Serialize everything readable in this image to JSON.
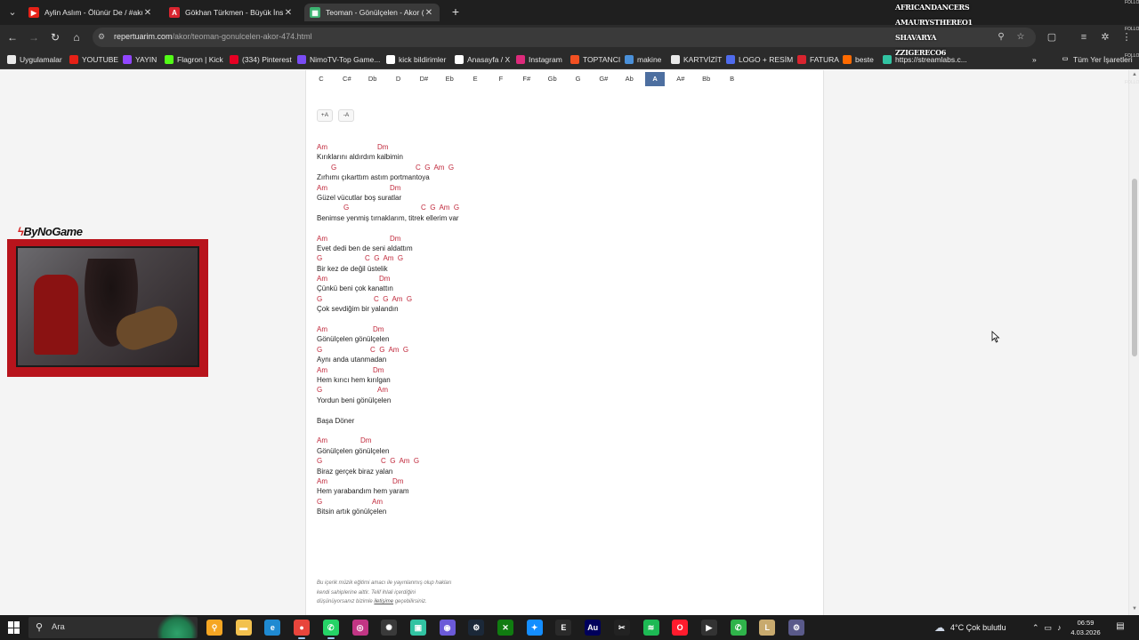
{
  "browser": {
    "tabs": [
      {
        "label": "Aylin Aslım - Ölünür De / #akus",
        "favicon": "youtube-icon",
        "color": "#e62117",
        "active": false
      },
      {
        "label": "Gökhan Türkmen - Büyük İnsan",
        "favicon": "A",
        "color": "#d9242f",
        "active": false
      },
      {
        "label": "Teoman - Gönülçelen - Akor (K",
        "favicon": "tabs-icon",
        "color": "#3cb371",
        "active": true
      }
    ],
    "url_host": "repertuarim.com",
    "url_path": "/akor/teoman-gonulcelen-akor-474.html",
    "overlay_names": [
      "AFRICANDANCERS",
      "AMAURYSTHEREO1",
      "SHAVARYA",
      "ZZIGERECO6"
    ],
    "side_tags": [
      "FOLLOW",
      "FOLLOW",
      "FOLLOW",
      "FOLLOW"
    ],
    "bookmarks": [
      {
        "label": "Uygulamalar",
        "icon": "apps-grid-icon",
        "color": "#e9e9e9"
      },
      {
        "label": "YOUTUBE",
        "icon": "youtube-icon",
        "color": "#e62117"
      },
      {
        "label": "YAYIN",
        "icon": "twitch-icon",
        "color": "#9146ff"
      },
      {
        "label": "Flagron | Kick",
        "icon": "kick-icon",
        "color": "#53fc18"
      },
      {
        "label": "(334) Pinterest",
        "icon": "pinterest-icon",
        "color": "#e60023"
      },
      {
        "label": "NimoTV-Top Game...",
        "icon": "nimo-icon",
        "color": "#7a4cf5"
      },
      {
        "label": "kick bildirimler",
        "icon": "kick-diamond-icon",
        "color": "#ffffff"
      },
      {
        "label": "Anasayfa / X",
        "icon": "x-icon",
        "color": "#ffffff"
      },
      {
        "label": "Instagram",
        "icon": "instagram-icon",
        "color": "#dd2a7b"
      },
      {
        "label": "TOPTANCI",
        "icon": "shop-icon",
        "color": "#f25022"
      },
      {
        "label": "makine",
        "icon": "doc-icon",
        "color": "#4a90d9"
      },
      {
        "label": "KARTVİZİT",
        "icon": "folder-icon",
        "color": "#e9e9e9"
      },
      {
        "label": "LOGO + RESİM",
        "icon": "logo-icon",
        "color": "#4f6bed"
      },
      {
        "label": "FATURA",
        "icon": "fatura-icon",
        "color": "#d9242f"
      },
      {
        "label": "beste",
        "icon": "beste-icon",
        "color": "#ff6a00"
      },
      {
        "label": "https://streamlabs.c...",
        "icon": "streamlabs-icon",
        "color": "#31c3a2"
      }
    ],
    "more_bookmarks": "»",
    "all_bookmarks": "Tüm Yer İşaretleri"
  },
  "page": {
    "keys": [
      "C",
      "C#",
      "Db",
      "D",
      "D#",
      "Eb",
      "E",
      "F",
      "F#",
      "Gb",
      "G",
      "G#",
      "Ab",
      "A",
      "A#",
      "Bb",
      "B"
    ],
    "selected_key": "A",
    "size_up": "+A",
    "size_down": "-A",
    "lyrics": [
      {
        "type": "chord",
        "chords": [
          {
            "c": "Am",
            "at": 0
          },
          {
            "c": "Dm",
            "at": 68
          }
        ]
      },
      {
        "type": "text",
        "t": "Kırıklarını aldırdım kalbimin"
      },
      {
        "type": "chord",
        "chords": [
          {
            "c": "G",
            "at": 16
          },
          {
            "c": "C  G  Am  G",
            "at": 111
          }
        ]
      },
      {
        "type": "text",
        "t": "Zırhımı çıkarttım astım portmantoya"
      },
      {
        "type": "chord",
        "chords": [
          {
            "c": "Am",
            "at": 0
          },
          {
            "c": "Dm",
            "at": 82
          }
        ]
      },
      {
        "type": "text",
        "t": "Güzel vücutlar boş suratlar"
      },
      {
        "type": "chord",
        "chords": [
          {
            "c": "G",
            "at": 30
          },
          {
            "c": "C  G  Am  G",
            "at": 117
          }
        ]
      },
      {
        "type": "text",
        "t": "Benimse yenmiş tırnaklarım, titrek ellerim var"
      },
      {
        "type": "blank"
      },
      {
        "type": "chord",
        "chords": [
          {
            "c": "Am",
            "at": 0
          },
          {
            "c": "Dm",
            "at": 82
          }
        ]
      },
      {
        "type": "text",
        "t": "Evet dedi ben de seni aldattım"
      },
      {
        "type": "chord",
        "chords": [
          {
            "c": "G",
            "at": 0
          },
          {
            "c": "C  G  Am  G",
            "at": 54
          }
        ]
      },
      {
        "type": "text",
        "t": "Bir kez de değil üstelik"
      },
      {
        "type": "chord",
        "chords": [
          {
            "c": "Am",
            "at": 0
          },
          {
            "c": "Dm",
            "at": 70
          }
        ]
      },
      {
        "type": "text",
        "t": "Çünkü beni çok kanattın"
      },
      {
        "type": "chord",
        "chords": [
          {
            "c": "G",
            "at": 0
          },
          {
            "c": "C  G  Am  G",
            "at": 64
          }
        ]
      },
      {
        "type": "text",
        "t": "Çok sevdiğim bir yalandın"
      },
      {
        "type": "blank"
      },
      {
        "type": "chord",
        "chords": [
          {
            "c": "Am",
            "at": 0
          },
          {
            "c": "Dm",
            "at": 63
          }
        ]
      },
      {
        "type": "text",
        "t": "Gönülçelen gönülçelen"
      },
      {
        "type": "chord",
        "chords": [
          {
            "c": "G",
            "at": 0
          },
          {
            "c": "C  G  Am  G",
            "at": 60
          }
        ]
      },
      {
        "type": "text",
        "t": "Aynı anda utanmadan"
      },
      {
        "type": "chord",
        "chords": [
          {
            "c": "Am",
            "at": 0
          },
          {
            "c": "Dm",
            "at": 63
          }
        ]
      },
      {
        "type": "text",
        "t": "Hem kırıcı hem kırılgan"
      },
      {
        "type": "chord",
        "chords": [
          {
            "c": "G",
            "at": 0
          },
          {
            "c": "Am",
            "at": 68
          }
        ]
      },
      {
        "type": "text",
        "t": "Yordun beni gönülçelen"
      },
      {
        "type": "blank"
      },
      {
        "type": "text",
        "t": "Başa Döner"
      },
      {
        "type": "blank"
      },
      {
        "type": "chord",
        "chords": [
          {
            "c": "Am",
            "at": 0
          },
          {
            "c": "Dm",
            "at": 49
          }
        ]
      },
      {
        "type": "text",
        "t": "Gönülçelen gönülçelen"
      },
      {
        "type": "chord",
        "chords": [
          {
            "c": "G",
            "at": 0
          },
          {
            "c": "C  G  Am  G",
            "at": 72
          }
        ]
      },
      {
        "type": "text",
        "t": "Biraz gerçek biraz yalan"
      },
      {
        "type": "chord",
        "chords": [
          {
            "c": "Am",
            "at": 0
          },
          {
            "c": "Dm",
            "at": 85
          }
        ]
      },
      {
        "type": "text",
        "t": "Hem yarabandım hem yaram"
      },
      {
        "type": "chord",
        "chords": [
          {
            "c": "G",
            "at": 0
          },
          {
            "c": "Am",
            "at": 62
          }
        ]
      },
      {
        "type": "text",
        "t": "Bitsin artık gönülçelen"
      }
    ],
    "disclaimer_1": "Bu içerik müzik eğitimi amacı ile yayınlanmış olup hakları",
    "disclaimer_2": "kendi sahiplerine aittir. Telif ihlali içerdiğini",
    "disclaimer_3a": "düşünüyorsanız bizimle ",
    "disclaimer_link": "iletişime",
    "disclaimer_3b": " geçebilirsiniz."
  },
  "overlay": {
    "cam_logo": "ByNoGame"
  },
  "taskbar": {
    "search_placeholder": "Ara",
    "apps": [
      {
        "name": "search-app-icon",
        "color": "#f5a623",
        "glyph": "⚲",
        "running": false
      },
      {
        "name": "file-explorer-icon",
        "color": "#f2c14e",
        "glyph": "▬",
        "running": false
      },
      {
        "name": "edge-icon",
        "color": "#1f8ad1",
        "glyph": "e",
        "running": false
      },
      {
        "name": "chrome-icon",
        "color": "#e8453c",
        "glyph": "●",
        "running": true
      },
      {
        "name": "whatsapp-icon",
        "color": "#25d366",
        "glyph": "✆",
        "running": true
      },
      {
        "name": "instagram-app-icon",
        "color": "#c13584",
        "glyph": "◎",
        "running": false
      },
      {
        "name": "chatgpt-icon",
        "color": "#3a3a3a",
        "glyph": "✺",
        "running": false
      },
      {
        "name": "streamlabs-app-icon",
        "color": "#31c3a2",
        "glyph": "▣",
        "running": false
      },
      {
        "name": "obs-app-icon",
        "color": "#6b5ad8",
        "glyph": "◉",
        "running": false
      },
      {
        "name": "steam-icon",
        "color": "#1b2838",
        "glyph": "⚙",
        "running": false
      },
      {
        "name": "xbox-icon",
        "color": "#107c10",
        "glyph": "✕",
        "running": false
      },
      {
        "name": "battlenet-icon",
        "color": "#148eff",
        "glyph": "✦",
        "running": false
      },
      {
        "name": "epic-games-icon",
        "color": "#2a2a2a",
        "glyph": "E",
        "running": false
      },
      {
        "name": "audition-icon",
        "color": "#00005b",
        "glyph": "Au",
        "running": false
      },
      {
        "name": "capcut-icon",
        "color": "#222222",
        "glyph": "✂",
        "running": false
      },
      {
        "name": "spotify-icon",
        "color": "#1db954",
        "glyph": "≋",
        "running": false
      },
      {
        "name": "opera-icon",
        "color": "#ff1b2d",
        "glyph": "O",
        "running": false
      },
      {
        "name": "media-player-icon",
        "color": "#333333",
        "glyph": "▶",
        "running": false
      },
      {
        "name": "phone-link-icon",
        "color": "#2fb34a",
        "glyph": "✆",
        "running": false
      },
      {
        "name": "league-icon",
        "color": "#c8aa6e",
        "glyph": "L",
        "running": false
      },
      {
        "name": "settings-app-icon",
        "color": "#5a5a8a",
        "glyph": "⚙",
        "running": false
      }
    ],
    "weather": "4°C  Çok bulutlu",
    "time": "06:59",
    "date": "4.03.2026"
  }
}
